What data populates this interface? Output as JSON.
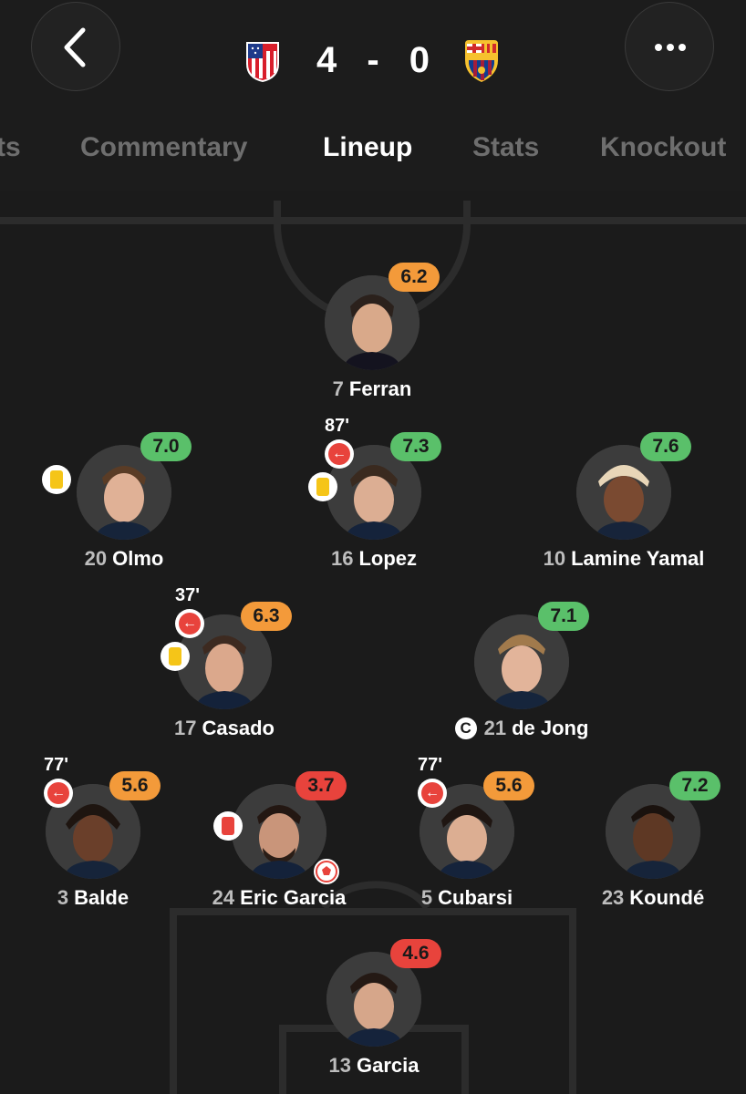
{
  "header": {
    "home_crest": "atletico-madrid-crest",
    "away_crest": "fc-barcelona-crest",
    "score": {
      "home": "4",
      "separator": "-",
      "away": "0"
    }
  },
  "tabs": [
    {
      "label": "ts",
      "active": false
    },
    {
      "label": "Commentary",
      "active": false
    },
    {
      "label": "Lineup",
      "active": true
    },
    {
      "label": "Stats",
      "active": false
    },
    {
      "label": "Knockout",
      "active": false
    }
  ],
  "colors": {
    "rating_green": "#5ac06a",
    "rating_orange": "#f39a3a",
    "rating_red": "#e8433c",
    "background": "#1b1b1b"
  },
  "players": [
    {
      "number": "7",
      "name": "Ferran",
      "rating": "6.2",
      "rating_color": "orange"
    },
    {
      "number": "20",
      "name": "Olmo",
      "rating": "7.0",
      "rating_color": "green",
      "card": "yellow"
    },
    {
      "number": "16",
      "name": "Lopez",
      "rating": "7.3",
      "rating_color": "green",
      "card": "yellow",
      "sub_time": "87'"
    },
    {
      "number": "10",
      "name": "Lamine Yamal",
      "rating": "7.6",
      "rating_color": "green"
    },
    {
      "number": "17",
      "name": "Casado",
      "rating": "6.3",
      "rating_color": "orange",
      "card": "yellow",
      "sub_time": "37'"
    },
    {
      "number": "21",
      "name": "de Jong",
      "rating": "7.1",
      "rating_color": "green",
      "captain": "C"
    },
    {
      "number": "3",
      "name": "Balde",
      "rating": "5.6",
      "rating_color": "orange",
      "sub_time": "77'"
    },
    {
      "number": "24",
      "name": "Eric Garcia",
      "rating": "3.7",
      "rating_color": "red",
      "card": "red",
      "own_goal": true
    },
    {
      "number": "5",
      "name": "Cubarsi",
      "rating": "5.6",
      "rating_color": "orange",
      "sub_time": "77'"
    },
    {
      "number": "23",
      "name": "Koundé",
      "rating": "7.2",
      "rating_color": "green"
    },
    {
      "number": "13",
      "name": "Garcia",
      "rating": "4.6",
      "rating_color": "red"
    }
  ]
}
